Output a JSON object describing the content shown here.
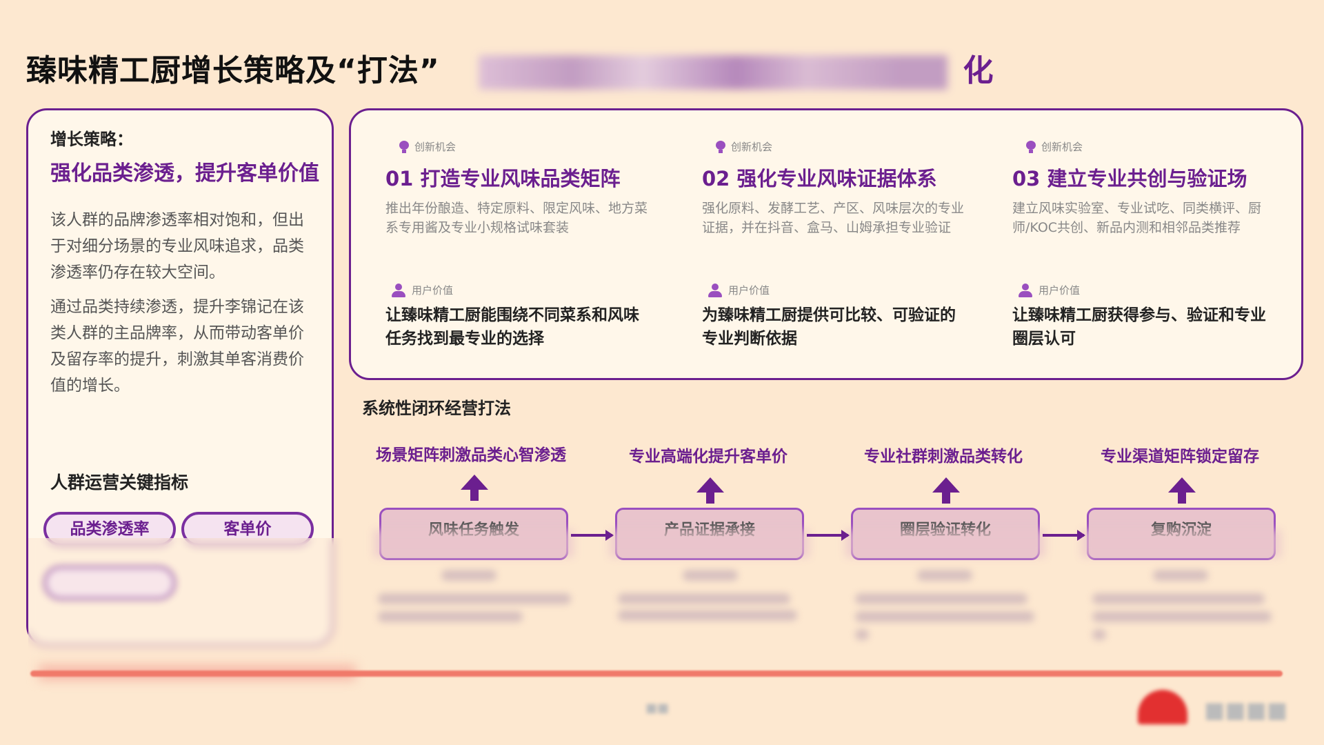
{
  "title": {
    "main": "臻味精工厨增长策略及“打法”",
    "tail": "化"
  },
  "left": {
    "head": "增长策略：",
    "strategy": "强化品类渗透，提升客单价值",
    "p1": "该人群的品牌渗透率相对饱和，但出于对细分场景的专业风味追求，品类渗透率仍存在较大空间。",
    "p2": "通过品类持续渗透，提升李锦记在该类人群的主品牌率，从而带动客单价及留存率的提升，刺激其单客消费价值的增长。",
    "kpi_title": "人群运营关键指标",
    "kpis": [
      "品类渗透率",
      "客单价"
    ]
  },
  "opportunities": [
    {
      "tag": "创新机会",
      "title": "01 打造专业风味品类矩阵",
      "desc": "推出年份酿造、特定原料、限定风味、地方菜系专用酱及专业小规格试味套装",
      "value_tag": "用户价值",
      "value": "让臻味精工厨能围绕不同菜系和风味任务找到最专业的选择"
    },
    {
      "tag": "创新机会",
      "title": "02 强化专业风味证据体系",
      "desc": "强化原料、发酵工艺、产区、风味层次的专业证据，并在抖音、盒马、山姆承担专业验证",
      "value_tag": "用户价值",
      "value": "为臻味精工厨提供可比较、可验证的专业判断依据"
    },
    {
      "tag": "创新机会",
      "title": "03 建立专业共创与验证场",
      "desc": "建立风味实验室、专业试吃、同类横评、厨师/KOC共创、新品内测和相邻品类推荐",
      "value_tag": "用户价值",
      "value": "让臻味精工厨获得参与、验证和专业圈层认可"
    }
  ],
  "flow": {
    "title": "系统性闭环经营打法",
    "goals": [
      "场景矩阵刺激品类心智渗透",
      "专业高端化提升客单价",
      "专业社群刺激品类转化",
      "专业渠道矩阵锁定留存"
    ],
    "stages": [
      "风味任务触发",
      "产品证据承接",
      "圈层验证转化",
      "复购沉淀"
    ]
  },
  "colors": {
    "accent": "#6b1f8f",
    "background": "#fde8d0",
    "footer_line": "#f07a6a"
  },
  "icons": [
    "bulb-icon",
    "person-icon",
    "up-arrow-icon",
    "right-arrow-icon"
  ]
}
